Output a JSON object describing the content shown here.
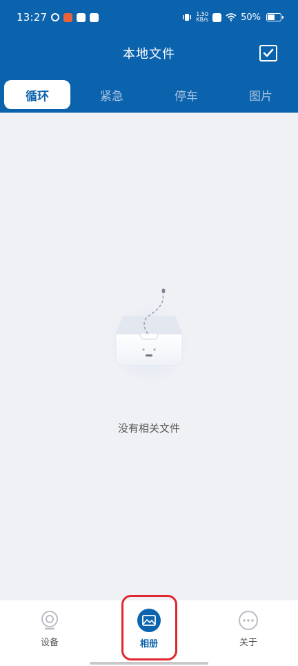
{
  "status_bar": {
    "time": "13:27",
    "net_speed_value": "1.50",
    "net_speed_unit": "KB/s",
    "battery": "50%"
  },
  "header": {
    "title": "本地文件"
  },
  "tabs": [
    {
      "label": "循环",
      "active": true
    },
    {
      "label": "紧急",
      "active": false
    },
    {
      "label": "停车",
      "active": false
    },
    {
      "label": "图片",
      "active": false
    }
  ],
  "empty_state": {
    "message": "没有相关文件"
  },
  "bottom_nav": {
    "items": [
      {
        "label": "设备",
        "icon": "camera-icon",
        "active": false
      },
      {
        "label": "相册",
        "icon": "album-icon",
        "active": true
      },
      {
        "label": "关于",
        "icon": "more-icon",
        "active": false
      }
    ]
  },
  "colors": {
    "primary": "#0b62ad",
    "highlight": "#e0262e",
    "background": "#f0f1f5"
  }
}
